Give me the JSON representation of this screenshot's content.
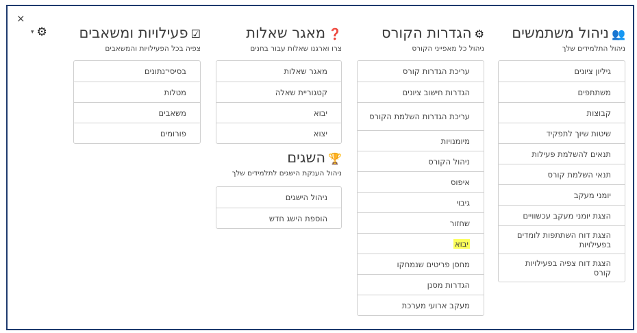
{
  "window": {
    "close_label": "×"
  },
  "menu": {
    "gear_caret": "▾"
  },
  "users": {
    "title": "ניהול משתמשים",
    "subtitle": "ניהול התלמידים שלך",
    "items": [
      "גיליון ציונים",
      "משתתפים",
      "קבוצות",
      "שיטות שיוך לתפקיד",
      "תנאים להשלמת פעילות",
      "תנאי השלמת קורס",
      "יומני מעקב",
      "הצגת יומני מעקב עכשוויים",
      "הצגת דוח השתתפות לומדים בפעילויות",
      "הצגת דוח צפיה בפעילויות קורס"
    ]
  },
  "course_settings": {
    "title": "הגדרות הקורס",
    "subtitle": "ניהול כל מאפייני הקורס",
    "items": [
      "עריכת הגדרות קורס",
      "הגדרות חישוב ציונים",
      "עריכת הגדרות השלמת הקורס",
      "מיומנויות",
      "ניהול הקורס",
      "איפוס",
      "גיבוי",
      "שחזור",
      "יבוא",
      "מחסן פריטים שנמחקו",
      "הגדרות מסנן",
      "מעקב ארועי מערכת"
    ]
  },
  "question_bank": {
    "title": "מאגר שאלות",
    "subtitle": "צרו וארגנו שאלות עבור בחנים",
    "items": [
      "מאגר שאלות",
      "קטגוריית שאלה",
      "יבוא",
      "יצוא"
    ]
  },
  "badges": {
    "title": "השגים",
    "subtitle": "ניהול הענקת הישגים לתלמידים שלך",
    "items": [
      "ניהול הישגים",
      "הוספת הישג חדש"
    ]
  },
  "activities": {
    "title": "פעילויות ומשאבים",
    "subtitle": "צפיה בכל הפעילויות והמשאבים",
    "items": [
      "בסיסי־נתונים",
      "מטלות",
      "משאבים",
      "פורומים"
    ]
  }
}
